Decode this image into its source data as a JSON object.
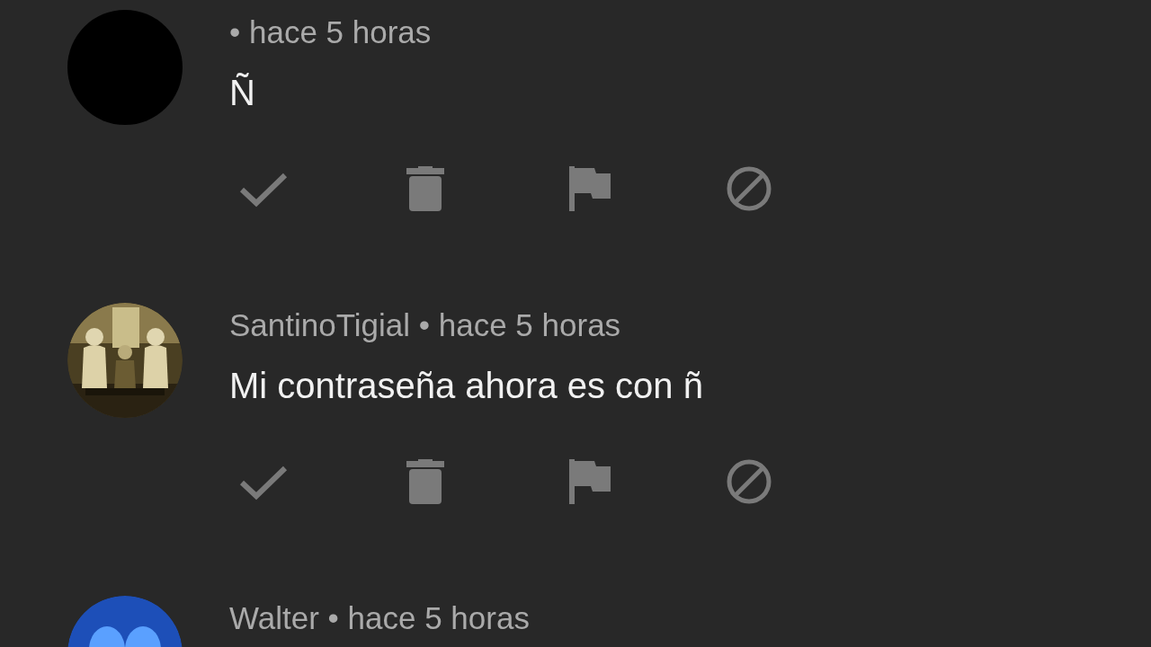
{
  "comments": [
    {
      "avatar": {
        "kind": "blank"
      },
      "meta": "• hace 5 horas",
      "text": "Ñ"
    },
    {
      "meta": "SantinoTigial • hace 5 horas",
      "text": "Mi contraseña ahora es con ñ"
    },
    {
      "avatar": {
        "kind": "cartoon"
      },
      "meta": "Walter • hace 5 horas"
    }
  ]
}
